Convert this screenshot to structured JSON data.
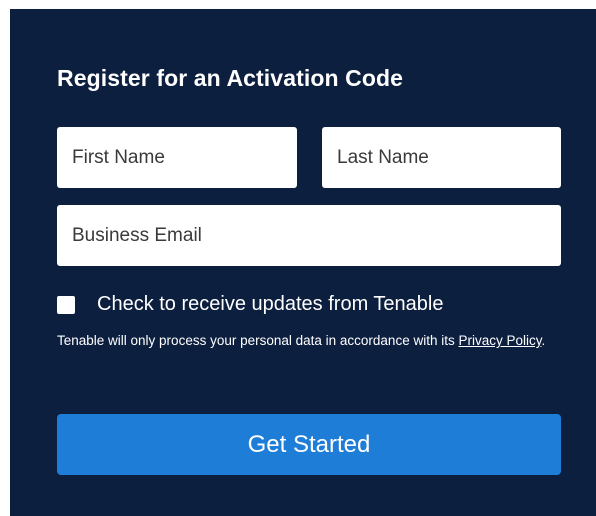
{
  "form": {
    "title": "Register for an Activation Code",
    "first_name_placeholder": "First Name",
    "last_name_placeholder": "Last Name",
    "email_placeholder": "Business Email",
    "updates_checkbox_label": "Check to receive updates from Tenable",
    "updates_checked": false,
    "privacy_text_before": "Tenable will only process your personal data in accordance with its ",
    "privacy_link_text": "Privacy Policy",
    "privacy_text_after": ".",
    "submit_label": "Get Started"
  },
  "colors": {
    "panel_background": "#0d1f3f",
    "button_background": "#1e7ed7",
    "text": "#ffffff"
  }
}
